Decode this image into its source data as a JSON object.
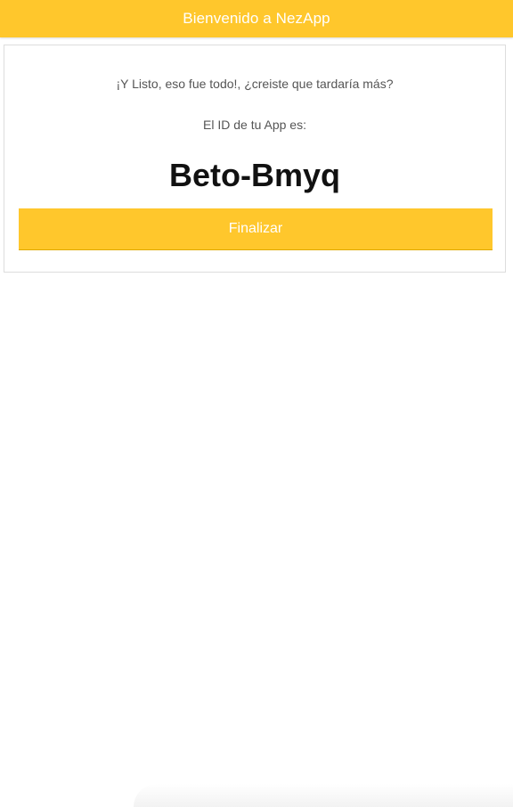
{
  "header": {
    "title": "Bienvenido a NezApp"
  },
  "card": {
    "message": "¡Y Listo, eso fue todo!, ¿creiste que tardaría más?",
    "id_label": "El ID de tu App es:",
    "app_id": "Beto-Bmyq",
    "finish_label": "Finalizar"
  },
  "colors": {
    "accent": "#ffc72c",
    "header_text": "#ffffff",
    "body_text": "#555555",
    "id_text": "#111111"
  }
}
